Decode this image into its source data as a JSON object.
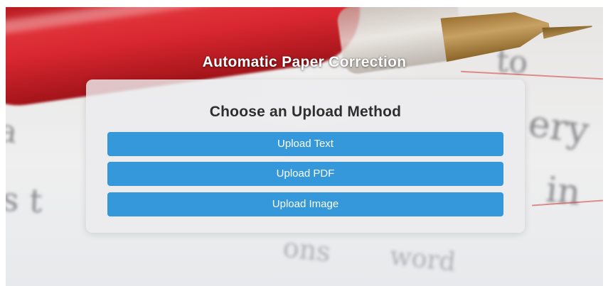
{
  "page": {
    "title": "Automatic Paper Correction"
  },
  "upload_card": {
    "heading": "Choose an Upload Method",
    "buttons": {
      "text": "Upload Text",
      "pdf": "Upload PDF",
      "image": "Upload Image"
    }
  },
  "colors": {
    "button": "#3498db",
    "button_text": "#ffffff",
    "heading_text": "#2e2e2e",
    "title_text": "#ffffff"
  }
}
